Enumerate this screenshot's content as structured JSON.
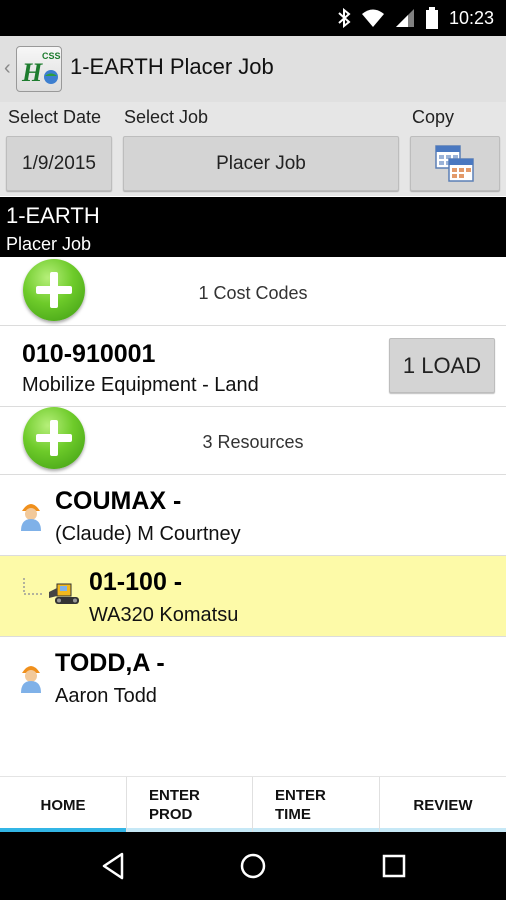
{
  "status_bar": {
    "time": "10:23"
  },
  "action_bar": {
    "title": "1-EARTH Placer Job",
    "logo_text": "CSS"
  },
  "selectors": {
    "date_label": "Select Date",
    "job_label": "Select Job",
    "copy_label": "Copy",
    "date_value": "1/9/2015",
    "job_value": "Placer Job"
  },
  "job_header": {
    "line1": "1-EARTH",
    "line2": "Placer Job"
  },
  "cost_codes": {
    "summary": "1 Cost Codes"
  },
  "cost_code_item": {
    "code": "010-910001",
    "description": "Mobilize Equipment - Land",
    "load_button": "1 LOAD"
  },
  "resources": {
    "summary": "3 Resources",
    "items": [
      {
        "code": "COUMAX -",
        "name": "(Claude) M Courtney",
        "icon": "worker-icon"
      },
      {
        "code": "01-100 -",
        "name": "WA320 Komatsu",
        "icon": "equipment-icon",
        "highlight": "#fdfaa8"
      },
      {
        "code": "TODD,A -",
        "name": "Aaron Todd",
        "icon": "worker-icon"
      }
    ]
  },
  "tabs": [
    {
      "label": "HOME",
      "active": true
    },
    {
      "label": "ENTER PROD"
    },
    {
      "label": "ENTER TIME"
    },
    {
      "label": "REVIEW"
    }
  ],
  "colors": {
    "accent": "#33b5e5",
    "highlight": "#fdfaa8",
    "header_bg": "#000000",
    "action_bar_bg": "#e0e0e0"
  }
}
